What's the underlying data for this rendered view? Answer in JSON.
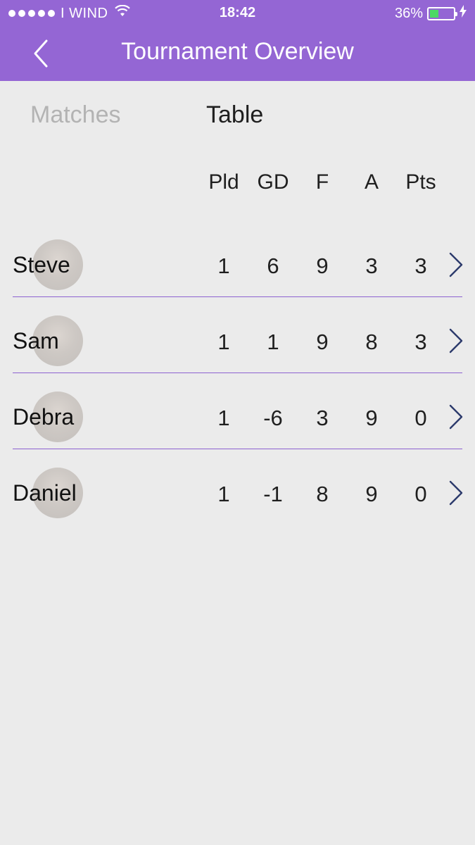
{
  "status_bar": {
    "carrier": "I WIND",
    "time": "18:42",
    "battery": "36%",
    "battery_level": 0.36,
    "signal_dots": 5
  },
  "nav": {
    "title": "Tournament Overview",
    "back_icon": "chevron-left-icon"
  },
  "tabs": [
    {
      "label": "Matches",
      "active": false
    },
    {
      "label": "Table",
      "active": true
    }
  ],
  "columns": [
    "Pld",
    "GD",
    "F",
    "A",
    "Pts"
  ],
  "rows": [
    {
      "name": "Steve",
      "values": [
        "1",
        "6",
        "9",
        "3",
        "3"
      ]
    },
    {
      "name": "Sam",
      "values": [
        "1",
        "1",
        "9",
        "8",
        "3"
      ]
    },
    {
      "name": "Debra",
      "values": [
        "1",
        "-6",
        "3",
        "9",
        "0"
      ]
    },
    {
      "name": "Daniel",
      "values": [
        "1",
        "-1",
        "8",
        "9",
        "0"
      ]
    }
  ],
  "colors": {
    "accent": "#9466d4",
    "background": "#ebebeb",
    "divider": "#8c62d0",
    "battery_fill": "#4cd964"
  }
}
